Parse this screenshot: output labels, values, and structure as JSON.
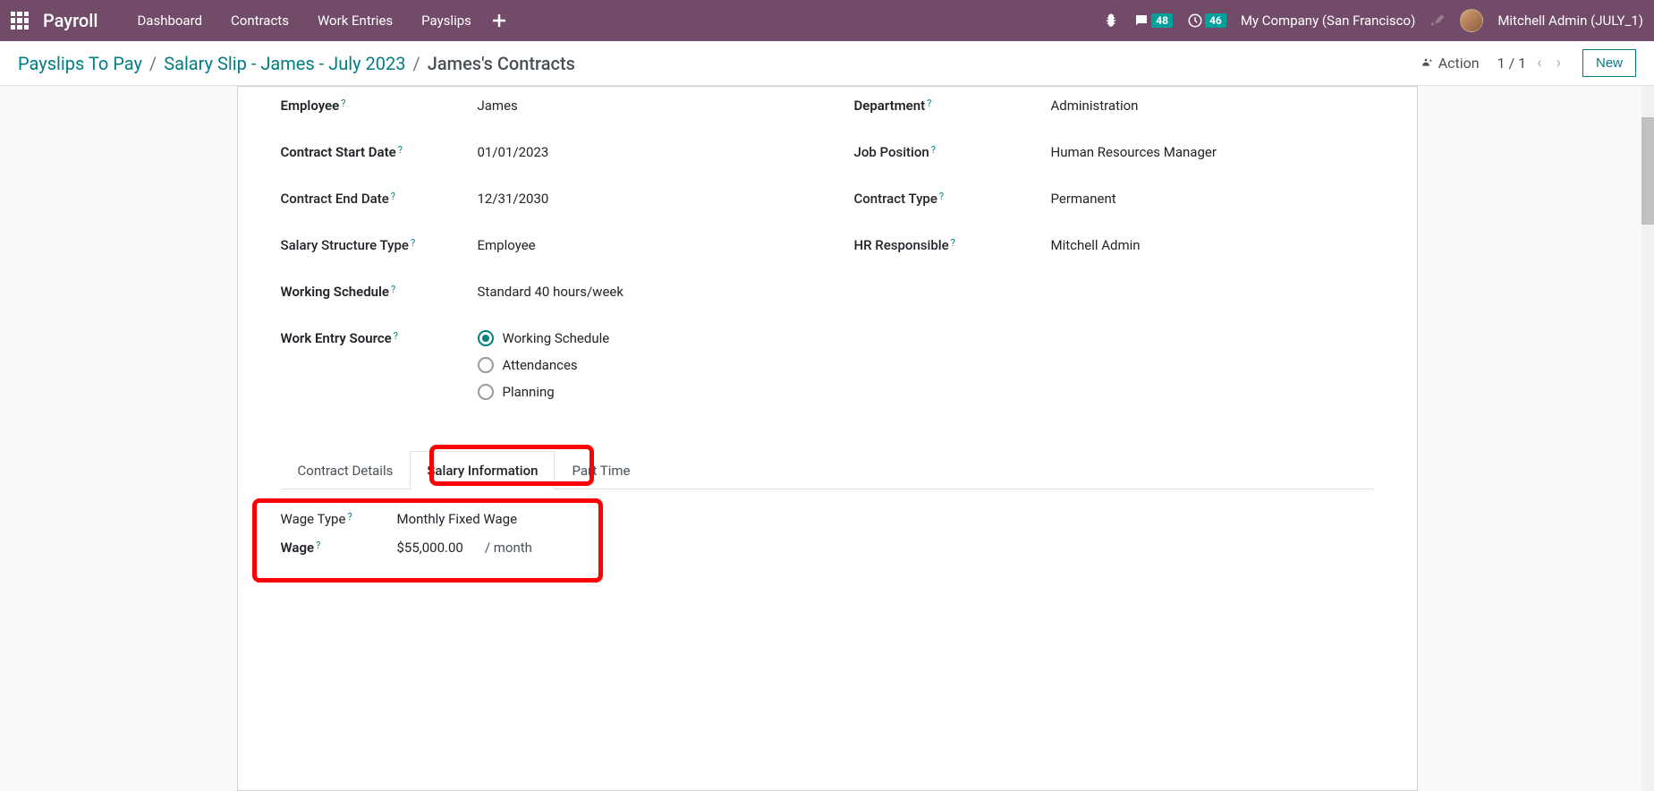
{
  "topbar": {
    "app_name": "Payroll",
    "nav": [
      "Dashboard",
      "Contracts",
      "Work Entries",
      "Payslips"
    ],
    "messages_badge": "48",
    "activities_badge": "46",
    "company": "My Company (San Francisco)",
    "user": "Mitchell Admin (JULY_1)"
  },
  "breadcrumbs": {
    "items": [
      "Payslips To Pay",
      "Salary Slip - James - July 2023"
    ],
    "current": "James's Contracts"
  },
  "subheader": {
    "action_label": "Action",
    "pager": "1 / 1",
    "new_label": "New"
  },
  "contract": {
    "left": {
      "employee_label": "Employee",
      "employee_value": "James",
      "start_date_label": "Contract Start Date",
      "start_date_value": "01/01/2023",
      "end_date_label": "Contract End Date",
      "end_date_value": "12/31/2030",
      "salary_structure_label": "Salary Structure Type",
      "salary_structure_value": "Employee",
      "working_schedule_label": "Working Schedule",
      "working_schedule_value": "Standard 40 hours/week",
      "work_entry_source_label": "Work Entry Source",
      "work_entry_options": [
        "Working Schedule",
        "Attendances",
        "Planning"
      ]
    },
    "right": {
      "department_label": "Department",
      "department_value": "Administration",
      "job_position_label": "Job Position",
      "job_position_value": "Human Resources Manager",
      "contract_type_label": "Contract Type",
      "contract_type_value": "Permanent",
      "hr_responsible_label": "HR Responsible",
      "hr_responsible_value": "Mitchell Admin"
    }
  },
  "tabs": {
    "items": [
      "Contract Details",
      "Salary Information",
      "Part Time"
    ],
    "active_index": 1
  },
  "salary_info": {
    "wage_type_label": "Wage Type",
    "wage_type_value": "Monthly Fixed Wage",
    "wage_label": "Wage",
    "wage_value": "$55,000.00",
    "wage_unit": "/ month"
  }
}
